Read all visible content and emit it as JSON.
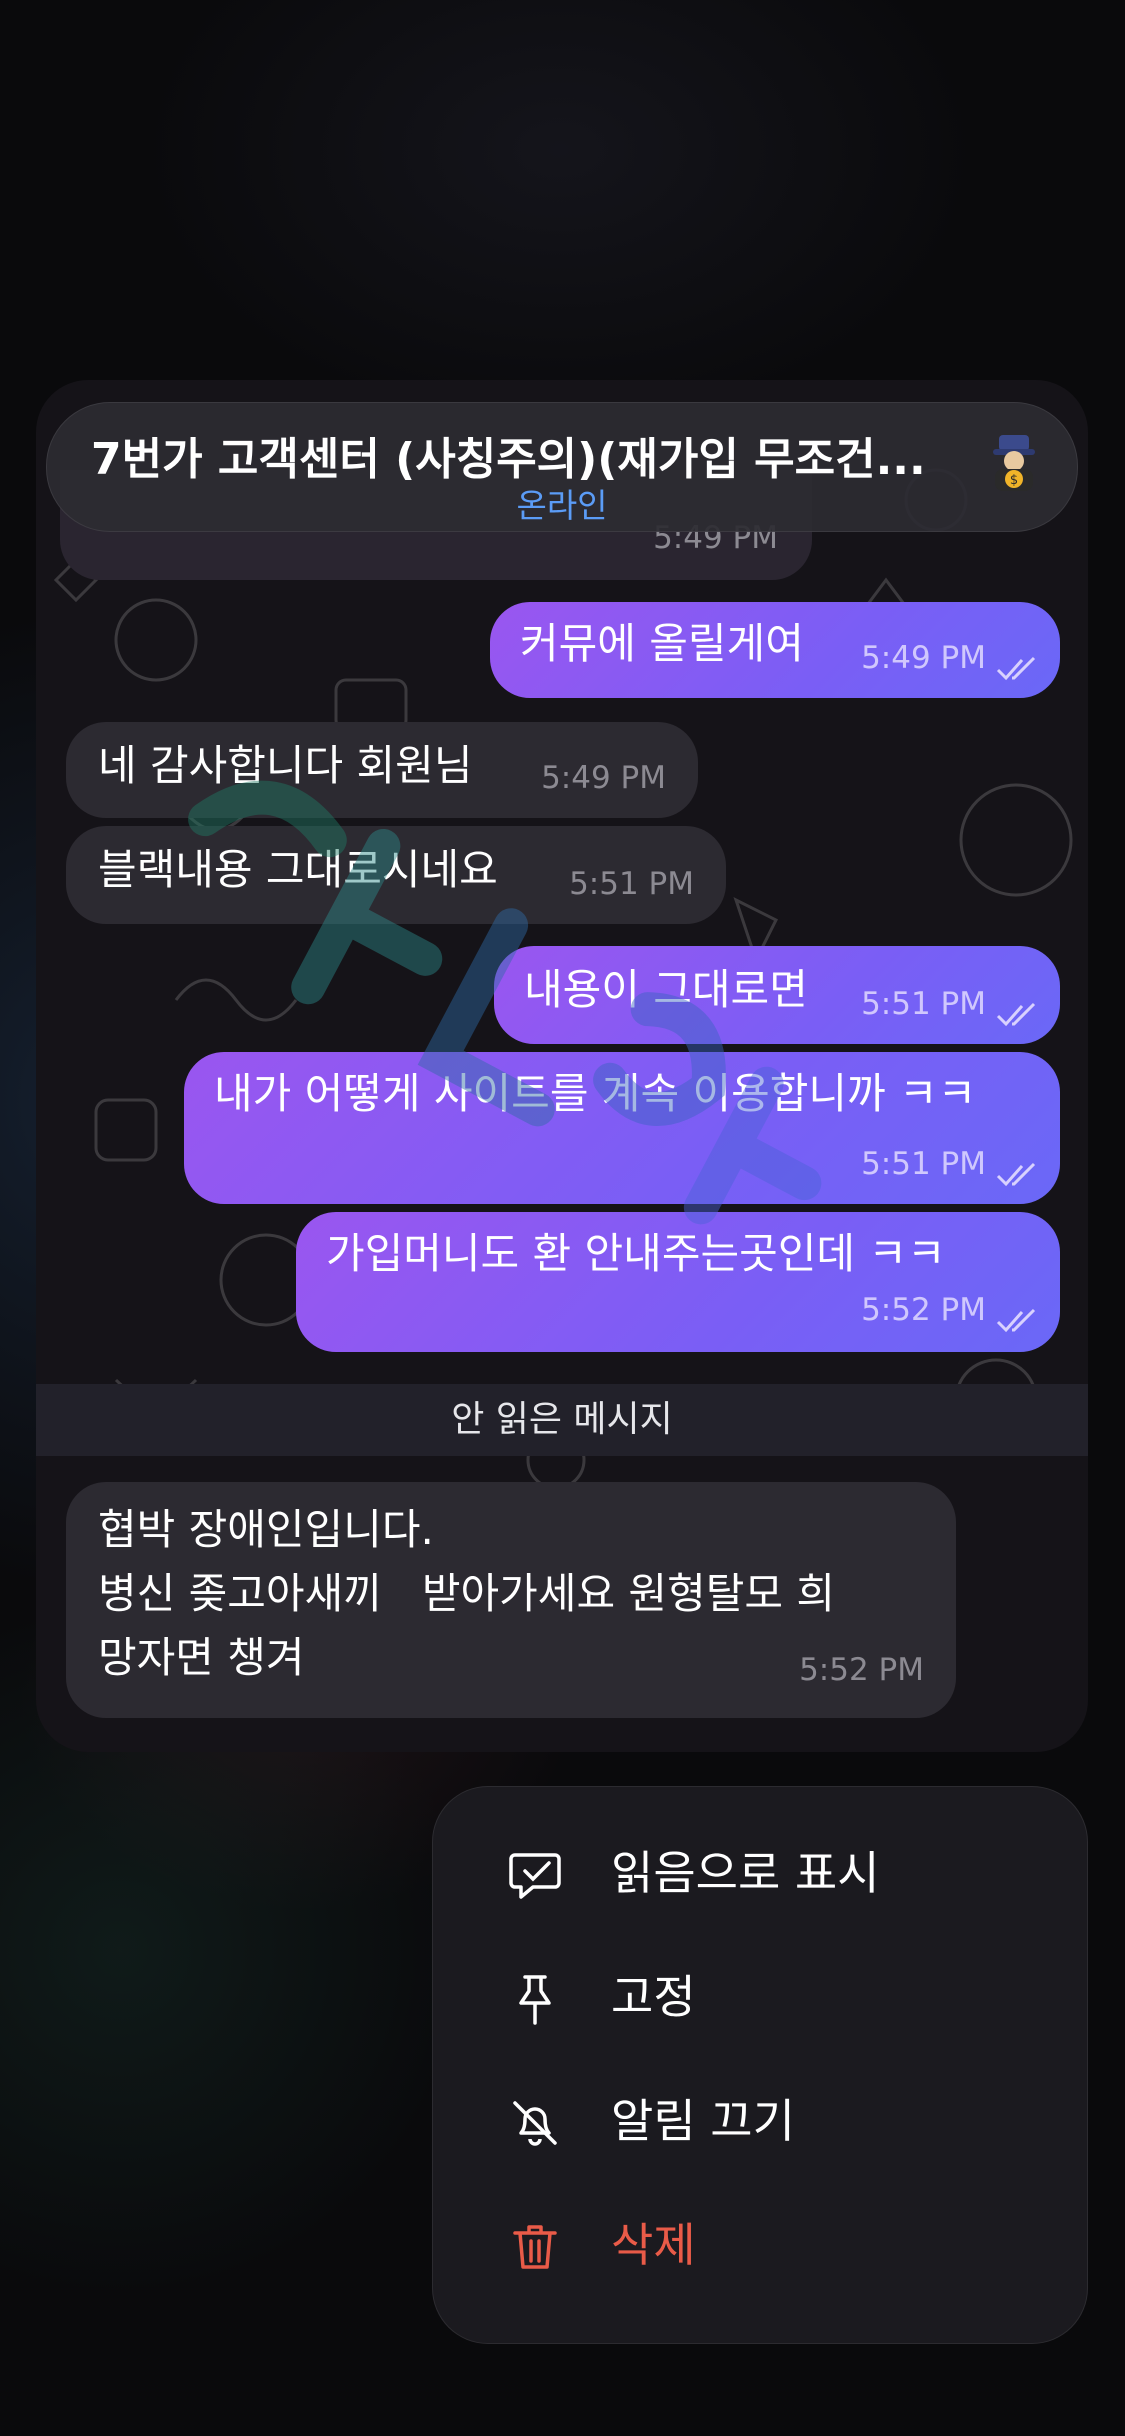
{
  "chat": {
    "title": "7번가 고객센터 (사칭주의)(재가입 무조건...",
    "status": "온라인",
    "partial_time": "5:49 PM",
    "messages": [
      {
        "dir": "out",
        "text": "커뮤에 올릴게여",
        "time": "5:49 PM",
        "read": true
      },
      {
        "dir": "in",
        "text": "네 감사합니다 회원님",
        "time": "5:49 PM"
      },
      {
        "dir": "in",
        "text": "블랙내용 그대로시네요",
        "time": "5:51 PM"
      },
      {
        "dir": "out",
        "text": "내용이 그대로면",
        "time": "5:51 PM",
        "read": true
      },
      {
        "dir": "out",
        "text": "내가 어떻게 사이트를 계속 이용합니까 ㅋㅋ",
        "time": "5:51 PM",
        "read": true
      },
      {
        "dir": "out",
        "text": "가입머니도 환 안내주는곳인데 ㅋㅋ",
        "time": "5:52 PM",
        "read": true
      }
    ],
    "unread_divider": "안 읽은 메시지",
    "last_message": {
      "dir": "in",
      "lines": [
        "협박 장애인입니다.",
        "병신 좆고아새끼   받아가세요 원형탈모 희",
        "망자면 챙겨"
      ],
      "time": "5:52 PM"
    }
  },
  "context_menu": {
    "items": [
      {
        "label": "읽음으로 표시",
        "icon": "chat-check-icon"
      },
      {
        "label": "고정",
        "icon": "pin-icon"
      },
      {
        "label": "알림 끄기",
        "icon": "bell-off-icon"
      },
      {
        "label": "삭제",
        "icon": "trash-icon",
        "color": "#e95b48"
      }
    ]
  },
  "colors": {
    "accent_status": "#5b9cf6",
    "outgoing_bubble": "#8a5cf3",
    "incoming_bubble": "#2c2a31",
    "danger": "#e95b48"
  }
}
